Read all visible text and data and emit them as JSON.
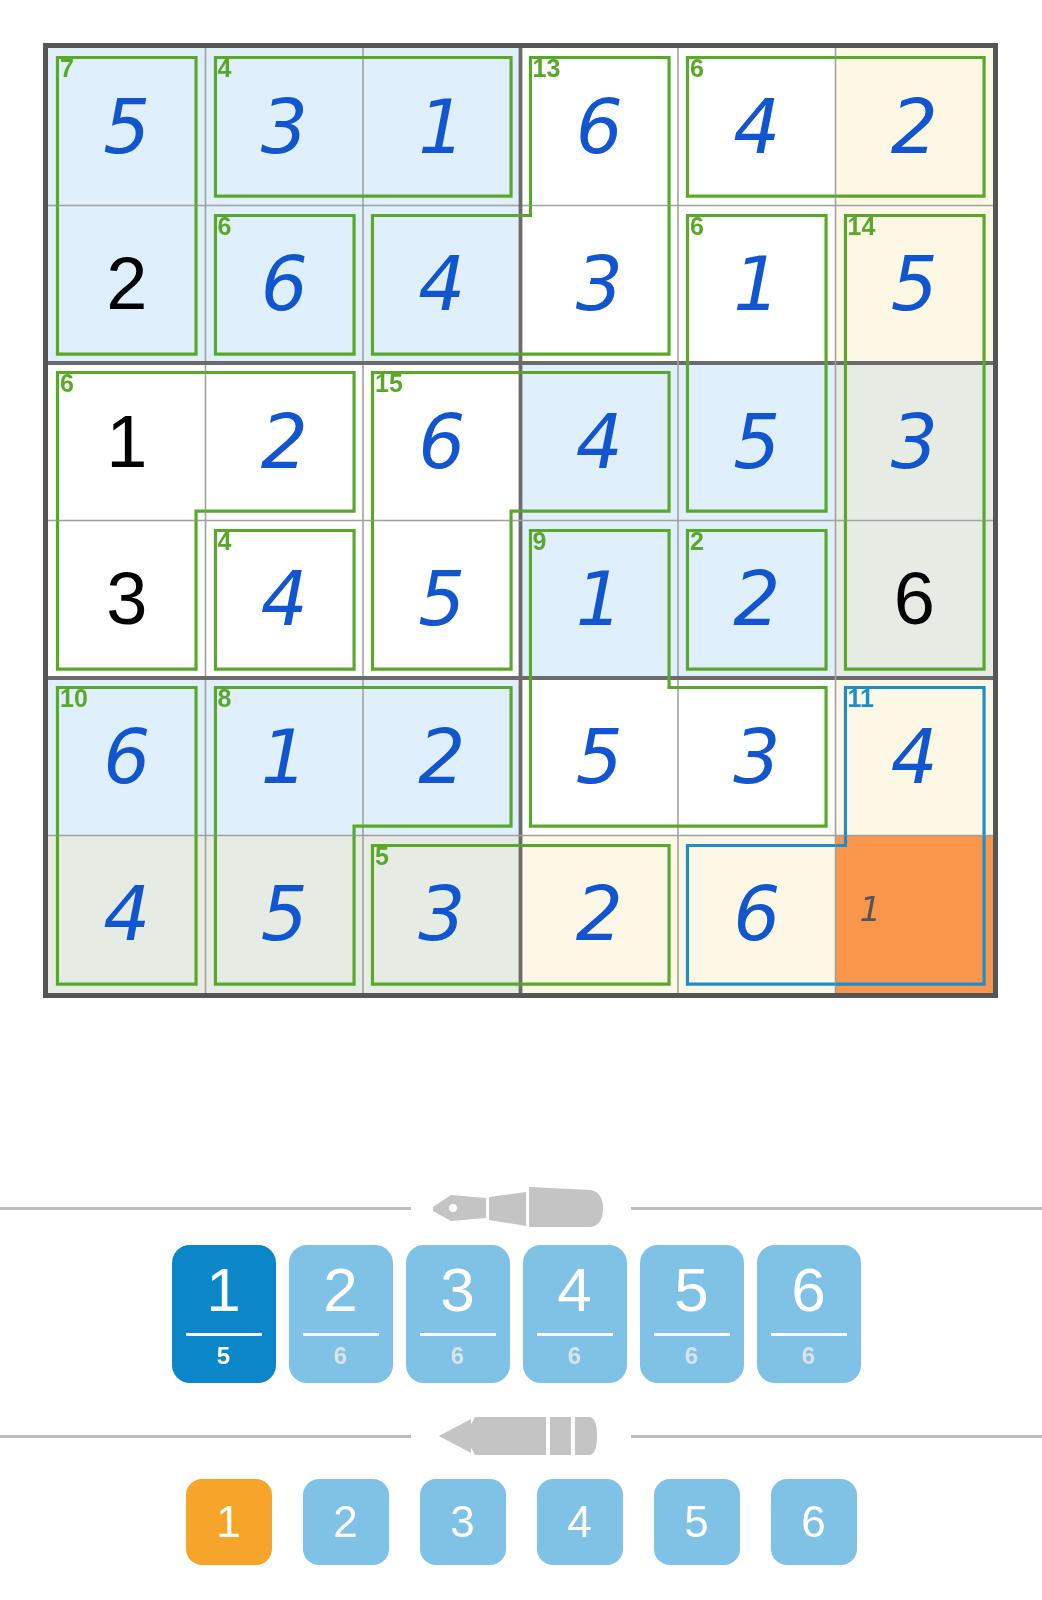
{
  "board": {
    "rows": [
      [
        {
          "value": "5",
          "kind": "entered",
          "color": "#dfeffb",
          "joined_right": false,
          "joined_down": true,
          "cage": {
            "sum": "7",
            "color": "#5aa82a"
          }
        },
        {
          "value": "3",
          "kind": "entered",
          "color": "#dfeffb",
          "joined_right": true,
          "joined_down": false,
          "cage": {
            "sum": "4",
            "color": "#5aa82a"
          }
        },
        {
          "value": "1",
          "kind": "entered",
          "color": "#dfeffb",
          "joined_right": false,
          "joined_down": false
        },
        {
          "value": "6",
          "kind": "entered",
          "color": "#ffffff",
          "joined_right": false,
          "joined_down": true,
          "cage": {
            "sum": "13",
            "color": "#5aa82a"
          }
        },
        {
          "value": "4",
          "kind": "entered",
          "color": "#ffffff",
          "joined_right": true,
          "joined_down": false,
          "cage": {
            "sum": "6",
            "color": "#5aa82a"
          }
        },
        {
          "value": "2",
          "kind": "entered",
          "color": "#fdf7e6",
          "joined_down": false
        }
      ],
      [
        {
          "value": "2",
          "kind": "given",
          "color": "#dfeffb",
          "joined_right": false,
          "joined_down": false
        },
        {
          "value": "6",
          "kind": "entered",
          "color": "#dfeffb",
          "joined_right": false,
          "joined_down": false,
          "cage": {
            "sum": "6",
            "color": "#5aa82a"
          }
        },
        {
          "value": "4",
          "kind": "entered",
          "color": "#dfeffb",
          "joined_right": true,
          "joined_down": false
        },
        {
          "value": "3",
          "kind": "entered",
          "color": "#ffffff",
          "joined_right": false,
          "joined_down": false
        },
        {
          "value": "1",
          "kind": "entered",
          "color": "#ffffff",
          "joined_right": false,
          "joined_down": true,
          "cage": {
            "sum": "6",
            "color": "#5aa82a"
          }
        },
        {
          "value": "5",
          "kind": "entered",
          "color": "#fdf7e6",
          "joined_down": true,
          "cage": {
            "sum": "14",
            "color": "#5aa82a"
          }
        }
      ],
      [
        {
          "value": "1",
          "kind": "given",
          "color": "#ffffff",
          "joined_right": true,
          "joined_down": true,
          "cage": {
            "sum": "6",
            "color": "#5aa82a"
          }
        },
        {
          "value": "2",
          "kind": "entered",
          "color": "#ffffff",
          "joined_right": false,
          "joined_down": false
        },
        {
          "value": "6",
          "kind": "entered",
          "color": "#ffffff",
          "joined_right": true,
          "joined_down": true,
          "cage": {
            "sum": "15",
            "color": "#5aa82a"
          }
        },
        {
          "value": "4",
          "kind": "entered",
          "color": "#dfeffb",
          "joined_right": false,
          "joined_down": false
        },
        {
          "value": "5",
          "kind": "entered",
          "color": "#dfeffb",
          "joined_right": false,
          "joined_down": false
        },
        {
          "value": "3",
          "kind": "entered",
          "color": "#e6ece4",
          "joined_down": true
        }
      ],
      [
        {
          "value": "3",
          "kind": "given",
          "color": "#ffffff",
          "joined_right": false,
          "joined_down": false
        },
        {
          "value": "4",
          "kind": "entered",
          "color": "#ffffff",
          "joined_right": false,
          "joined_down": false,
          "cage": {
            "sum": "4",
            "color": "#5aa82a"
          }
        },
        {
          "value": "5",
          "kind": "entered",
          "color": "#ffffff",
          "joined_right": false,
          "joined_down": false
        },
        {
          "value": "1",
          "kind": "entered",
          "color": "#dfeffb",
          "joined_right": false,
          "joined_down": true,
          "cage": {
            "sum": "9",
            "color": "#5aa82a"
          }
        },
        {
          "value": "2",
          "kind": "entered",
          "color": "#dfeffb",
          "joined_right": false,
          "joined_down": false,
          "cage": {
            "sum": "2",
            "color": "#5aa82a"
          }
        },
        {
          "value": "6",
          "kind": "given",
          "color": "#e6ece4",
          "joined_down": false
        }
      ],
      [
        {
          "value": "6",
          "kind": "entered",
          "color": "#dfeffb",
          "joined_right": false,
          "joined_down": true,
          "cage": {
            "sum": "10",
            "color": "#5aa82a"
          }
        },
        {
          "value": "1",
          "kind": "entered",
          "color": "#dfeffb",
          "joined_right": true,
          "joined_down": true,
          "cage": {
            "sum": "8",
            "color": "#5aa82a"
          }
        },
        {
          "value": "2",
          "kind": "entered",
          "color": "#dfeffb",
          "joined_right": false,
          "joined_down": false
        },
        {
          "value": "5",
          "kind": "entered",
          "color": "#ffffff",
          "joined_right": true,
          "joined_down": false
        },
        {
          "value": "3",
          "kind": "entered",
          "color": "#ffffff",
          "joined_right": false,
          "joined_down": false
        },
        {
          "value": "4",
          "kind": "entered",
          "color": "#fdf7e6",
          "joined_down": true,
          "cage": {
            "sum": "11",
            "color": "#1a8fd0"
          }
        }
      ],
      [
        {
          "value": "4",
          "kind": "entered",
          "color": "#e6ece4",
          "joined_right": false
        },
        {
          "value": "5",
          "kind": "entered",
          "color": "#e6ece4",
          "joined_right": false
        },
        {
          "value": "3",
          "kind": "entered",
          "color": "#e6ece4",
          "joined_right": true,
          "cage": {
            "sum": "5",
            "color": "#5aa82a"
          }
        },
        {
          "value": "2",
          "kind": "entered",
          "color": "#fdf7e6",
          "joined_right": false
        },
        {
          "value": "6",
          "kind": "entered",
          "color": "#fdf7e6",
          "joined_right": true
        },
        {
          "value": "1",
          "kind": "note",
          "color": "#fa964c"
        }
      ]
    ]
  },
  "pen_keys": [
    {
      "label": "1",
      "count": "5",
      "selected": true
    },
    {
      "label": "2",
      "count": "6",
      "selected": false
    },
    {
      "label": "3",
      "count": "6",
      "selected": false
    },
    {
      "label": "4",
      "count": "6",
      "selected": false
    },
    {
      "label": "5",
      "count": "6",
      "selected": false
    },
    {
      "label": "6",
      "count": "6",
      "selected": false
    }
  ],
  "pencil_keys": [
    {
      "label": "1",
      "selected": true
    },
    {
      "label": "2",
      "selected": false
    },
    {
      "label": "3",
      "selected": false
    },
    {
      "label": "4",
      "selected": false
    },
    {
      "label": "5",
      "selected": false
    },
    {
      "label": "6",
      "selected": false
    }
  ]
}
